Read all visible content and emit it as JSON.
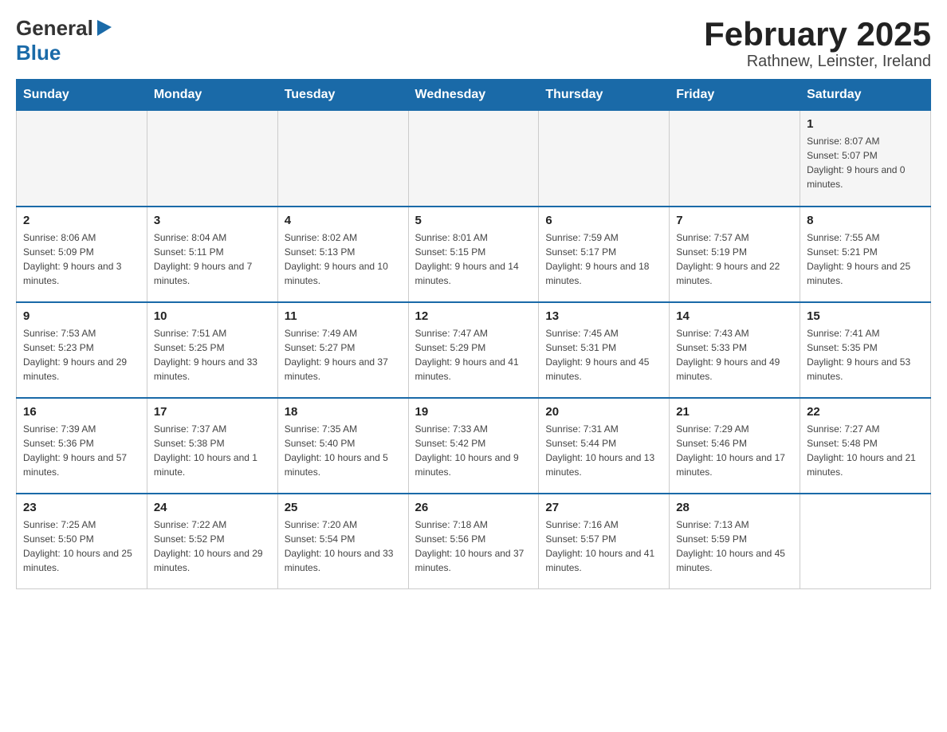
{
  "header": {
    "logo_general": "General",
    "logo_blue": "Blue",
    "title": "February 2025",
    "subtitle": "Rathnew, Leinster, Ireland"
  },
  "weekdays": [
    "Sunday",
    "Monday",
    "Tuesday",
    "Wednesday",
    "Thursday",
    "Friday",
    "Saturday"
  ],
  "weeks": [
    [
      {
        "day": "",
        "sunrise": "",
        "sunset": "",
        "daylight": ""
      },
      {
        "day": "",
        "sunrise": "",
        "sunset": "",
        "daylight": ""
      },
      {
        "day": "",
        "sunrise": "",
        "sunset": "",
        "daylight": ""
      },
      {
        "day": "",
        "sunrise": "",
        "sunset": "",
        "daylight": ""
      },
      {
        "day": "",
        "sunrise": "",
        "sunset": "",
        "daylight": ""
      },
      {
        "day": "",
        "sunrise": "",
        "sunset": "",
        "daylight": ""
      },
      {
        "day": "1",
        "sunrise": "Sunrise: 8:07 AM",
        "sunset": "Sunset: 5:07 PM",
        "daylight": "Daylight: 9 hours and 0 minutes."
      }
    ],
    [
      {
        "day": "2",
        "sunrise": "Sunrise: 8:06 AM",
        "sunset": "Sunset: 5:09 PM",
        "daylight": "Daylight: 9 hours and 3 minutes."
      },
      {
        "day": "3",
        "sunrise": "Sunrise: 8:04 AM",
        "sunset": "Sunset: 5:11 PM",
        "daylight": "Daylight: 9 hours and 7 minutes."
      },
      {
        "day": "4",
        "sunrise": "Sunrise: 8:02 AM",
        "sunset": "Sunset: 5:13 PM",
        "daylight": "Daylight: 9 hours and 10 minutes."
      },
      {
        "day": "5",
        "sunrise": "Sunrise: 8:01 AM",
        "sunset": "Sunset: 5:15 PM",
        "daylight": "Daylight: 9 hours and 14 minutes."
      },
      {
        "day": "6",
        "sunrise": "Sunrise: 7:59 AM",
        "sunset": "Sunset: 5:17 PM",
        "daylight": "Daylight: 9 hours and 18 minutes."
      },
      {
        "day": "7",
        "sunrise": "Sunrise: 7:57 AM",
        "sunset": "Sunset: 5:19 PM",
        "daylight": "Daylight: 9 hours and 22 minutes."
      },
      {
        "day": "8",
        "sunrise": "Sunrise: 7:55 AM",
        "sunset": "Sunset: 5:21 PM",
        "daylight": "Daylight: 9 hours and 25 minutes."
      }
    ],
    [
      {
        "day": "9",
        "sunrise": "Sunrise: 7:53 AM",
        "sunset": "Sunset: 5:23 PM",
        "daylight": "Daylight: 9 hours and 29 minutes."
      },
      {
        "day": "10",
        "sunrise": "Sunrise: 7:51 AM",
        "sunset": "Sunset: 5:25 PM",
        "daylight": "Daylight: 9 hours and 33 minutes."
      },
      {
        "day": "11",
        "sunrise": "Sunrise: 7:49 AM",
        "sunset": "Sunset: 5:27 PM",
        "daylight": "Daylight: 9 hours and 37 minutes."
      },
      {
        "day": "12",
        "sunrise": "Sunrise: 7:47 AM",
        "sunset": "Sunset: 5:29 PM",
        "daylight": "Daylight: 9 hours and 41 minutes."
      },
      {
        "day": "13",
        "sunrise": "Sunrise: 7:45 AM",
        "sunset": "Sunset: 5:31 PM",
        "daylight": "Daylight: 9 hours and 45 minutes."
      },
      {
        "day": "14",
        "sunrise": "Sunrise: 7:43 AM",
        "sunset": "Sunset: 5:33 PM",
        "daylight": "Daylight: 9 hours and 49 minutes."
      },
      {
        "day": "15",
        "sunrise": "Sunrise: 7:41 AM",
        "sunset": "Sunset: 5:35 PM",
        "daylight": "Daylight: 9 hours and 53 minutes."
      }
    ],
    [
      {
        "day": "16",
        "sunrise": "Sunrise: 7:39 AM",
        "sunset": "Sunset: 5:36 PM",
        "daylight": "Daylight: 9 hours and 57 minutes."
      },
      {
        "day": "17",
        "sunrise": "Sunrise: 7:37 AM",
        "sunset": "Sunset: 5:38 PM",
        "daylight": "Daylight: 10 hours and 1 minute."
      },
      {
        "day": "18",
        "sunrise": "Sunrise: 7:35 AM",
        "sunset": "Sunset: 5:40 PM",
        "daylight": "Daylight: 10 hours and 5 minutes."
      },
      {
        "day": "19",
        "sunrise": "Sunrise: 7:33 AM",
        "sunset": "Sunset: 5:42 PM",
        "daylight": "Daylight: 10 hours and 9 minutes."
      },
      {
        "day": "20",
        "sunrise": "Sunrise: 7:31 AM",
        "sunset": "Sunset: 5:44 PM",
        "daylight": "Daylight: 10 hours and 13 minutes."
      },
      {
        "day": "21",
        "sunrise": "Sunrise: 7:29 AM",
        "sunset": "Sunset: 5:46 PM",
        "daylight": "Daylight: 10 hours and 17 minutes."
      },
      {
        "day": "22",
        "sunrise": "Sunrise: 7:27 AM",
        "sunset": "Sunset: 5:48 PM",
        "daylight": "Daylight: 10 hours and 21 minutes."
      }
    ],
    [
      {
        "day": "23",
        "sunrise": "Sunrise: 7:25 AM",
        "sunset": "Sunset: 5:50 PM",
        "daylight": "Daylight: 10 hours and 25 minutes."
      },
      {
        "day": "24",
        "sunrise": "Sunrise: 7:22 AM",
        "sunset": "Sunset: 5:52 PM",
        "daylight": "Daylight: 10 hours and 29 minutes."
      },
      {
        "day": "25",
        "sunrise": "Sunrise: 7:20 AM",
        "sunset": "Sunset: 5:54 PM",
        "daylight": "Daylight: 10 hours and 33 minutes."
      },
      {
        "day": "26",
        "sunrise": "Sunrise: 7:18 AM",
        "sunset": "Sunset: 5:56 PM",
        "daylight": "Daylight: 10 hours and 37 minutes."
      },
      {
        "day": "27",
        "sunrise": "Sunrise: 7:16 AM",
        "sunset": "Sunset: 5:57 PM",
        "daylight": "Daylight: 10 hours and 41 minutes."
      },
      {
        "day": "28",
        "sunrise": "Sunrise: 7:13 AM",
        "sunset": "Sunset: 5:59 PM",
        "daylight": "Daylight: 10 hours and 45 minutes."
      },
      {
        "day": "",
        "sunrise": "",
        "sunset": "",
        "daylight": ""
      }
    ]
  ]
}
